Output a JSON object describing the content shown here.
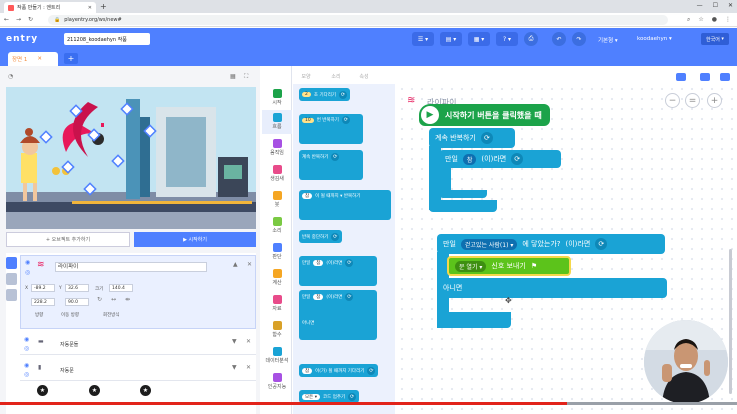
{
  "browser": {
    "tab_title": "작품 만들기 : 엔트리",
    "url": "playentry.org/ws/new#"
  },
  "app": {
    "logo": "entry",
    "project_name": "211208_koodaehyn 작품",
    "basic_mode": "기본형",
    "user": "koodaehyn",
    "language": "한국어"
  },
  "scene": {
    "tab_label": "장면 1"
  },
  "stage": {
    "add_object": "+ 오브젝트 추가하기",
    "run": "▶ 시작하기"
  },
  "object": {
    "name": "라이파이",
    "x": "-89.2",
    "y": "32.6",
    "size_label": "크기",
    "size": "140.4",
    "rotation": "228.2",
    "direction": "90.0",
    "label_direction": "방향",
    "label_move_direction": "이동 방향",
    "label_rotation": "회전방식",
    "list": [
      "자동문들",
      "자동문"
    ]
  },
  "palette_tabs": [
    "블록",
    "모양",
    "소리",
    "속성"
  ],
  "categories": [
    "시작",
    "흐름",
    "움직임",
    "생김새",
    "붓",
    "소리",
    "판단",
    "계산",
    "자료",
    "함수",
    "데이터분석",
    "인공지능"
  ],
  "palette_blocks": [
    {
      "pre": "2",
      "text": "초 기다리기"
    },
    {
      "pre": "10",
      "text": "번 반복하기"
    },
    {
      "pre": "",
      "text": "계속 반복하기"
    },
    {
      "pre": "참",
      "text": "이 될 때까지 ▾ 반복하기"
    },
    {
      "pre": "",
      "text": "반복 중단하기"
    },
    {
      "pre": "만일",
      "mid": "참",
      "text": "(이)라면"
    },
    {
      "pre": "만일",
      "mid": "참",
      "text": "(이)라면"
    },
    {
      "pre": "",
      "text": "아니면"
    },
    {
      "pre": "참",
      "text": "이(가) 될 때까지 기다리기"
    },
    {
      "pre": "모든 ▾",
      "text": "코드 멈추기"
    }
  ],
  "workspace": {
    "object_label": "라이파이",
    "hat": "시작하기 버튼을 클릭했을 때",
    "forever": "계속 반복하기",
    "if_label": "만일",
    "true_label": "참",
    "then_label": "(이)라면",
    "if2_target": "걷고있는 사람(1) ▾",
    "if2_cond": "에 닿았는가?",
    "if2_then": "(이)라면",
    "signal_target": "문 열기 ▾",
    "signal_text": "신호 보내기",
    "else_label": "아니면"
  },
  "colors": {
    "brand": "#4f80ff",
    "flow_block": "#1aa3d5",
    "start_block": "#1ca34a",
    "signal_block": "#5cc31b",
    "video_progress": "#e2231a"
  },
  "video": {
    "progress": 0.77
  }
}
